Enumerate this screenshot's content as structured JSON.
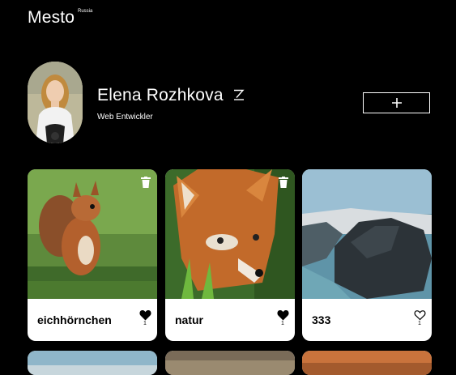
{
  "header": {
    "logo": "Mesto",
    "logo_sup": "Russia"
  },
  "profile": {
    "name": "Elena Rozhkova",
    "job": "Web Entwickler",
    "add_label": "+"
  },
  "cards": [
    {
      "title": "eichhörnchen",
      "likes": "1",
      "liked": true
    },
    {
      "title": "natur",
      "likes": "1",
      "liked": true
    },
    {
      "title": "333",
      "likes": "1",
      "liked": false
    }
  ]
}
